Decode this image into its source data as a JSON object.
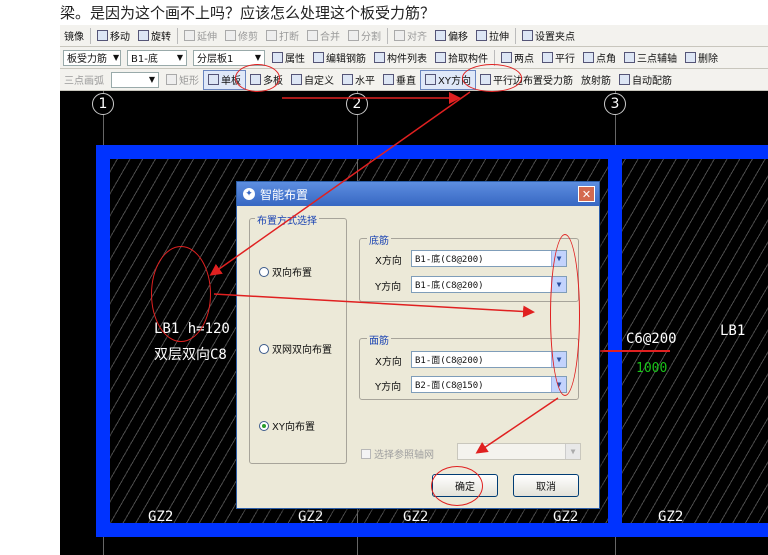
{
  "question": "梁。是因为这个画不上吗？应该怎么处理这个板受力筋？",
  "toolbar1": {
    "items": [
      {
        "label": "镜像",
        "enabled": true
      },
      {
        "label": "移动",
        "enabled": true
      },
      {
        "label": "旋转",
        "enabled": true
      },
      {
        "label": "延伸",
        "enabled": false
      },
      {
        "label": "修剪",
        "enabled": false
      },
      {
        "label": "打断",
        "enabled": false
      },
      {
        "label": "合并",
        "enabled": false
      },
      {
        "label": "分割",
        "enabled": false
      },
      {
        "label": "对齐",
        "enabled": false
      },
      {
        "label": "偏移",
        "enabled": true
      },
      {
        "label": "拉伸",
        "enabled": true
      },
      {
        "label": "设置夹点",
        "enabled": true
      }
    ]
  },
  "toolbar2": {
    "type_select": "板受力筋",
    "name_select": "B1-底",
    "layer_select": "分层板1",
    "items": [
      "属性",
      "编辑钢筋",
      "构件列表",
      "拾取构件",
      "两点",
      "平行",
      "点角",
      "三点辅轴",
      "删除"
    ]
  },
  "toolbar3": {
    "items": [
      {
        "label": "三点画弧",
        "enabled": false
      },
      {
        "label": "矩形",
        "enabled": false
      },
      {
        "label": "单板",
        "enabled": true,
        "pressed": true
      },
      {
        "label": "多板",
        "enabled": true
      },
      {
        "label": "自定义",
        "enabled": true
      },
      {
        "label": "水平",
        "enabled": true
      },
      {
        "label": "垂直",
        "enabled": true
      },
      {
        "label": "XY方向",
        "enabled": true,
        "pressed": true
      },
      {
        "label": "平行边布置受力筋",
        "enabled": true
      },
      {
        "label": "放射筋",
        "enabled": true
      },
      {
        "label": "自动配筋",
        "enabled": true
      }
    ]
  },
  "canvas": {
    "axes": [
      "1",
      "2",
      "3"
    ],
    "slab_label_1": "LB1 h=120",
    "slab_label_2": "双层双向C8",
    "rebar_label": "C6@200",
    "dimension": "1000",
    "slab_label_right": "LB1",
    "column_labels": [
      "GZ2",
      "GZ2",
      "GZ2",
      "GZ2",
      "GZ2"
    ]
  },
  "dialog": {
    "title": "智能布置",
    "close": "✕",
    "layout_group_label": "布置方式选择",
    "options": [
      {
        "label": "双向布置",
        "selected": false
      },
      {
        "label": "双网双向布置",
        "selected": false
      },
      {
        "label": "XY向布置",
        "selected": true
      }
    ],
    "bottom_group": {
      "label": "底筋",
      "x_label": "X方向",
      "x_value": "B1-底(C8@200)",
      "y_label": "Y方向",
      "y_value": "B1-底(C8@200)"
    },
    "top_group": {
      "label": "面筋",
      "x_label": "X方向",
      "x_value": "B1-面(C8@200)",
      "y_label": "Y方向",
      "y_value": "B2-面(C8@150)"
    },
    "ref_axis_label": "选择参照轴网",
    "ok_label": "确定",
    "cancel_label": "取消"
  }
}
